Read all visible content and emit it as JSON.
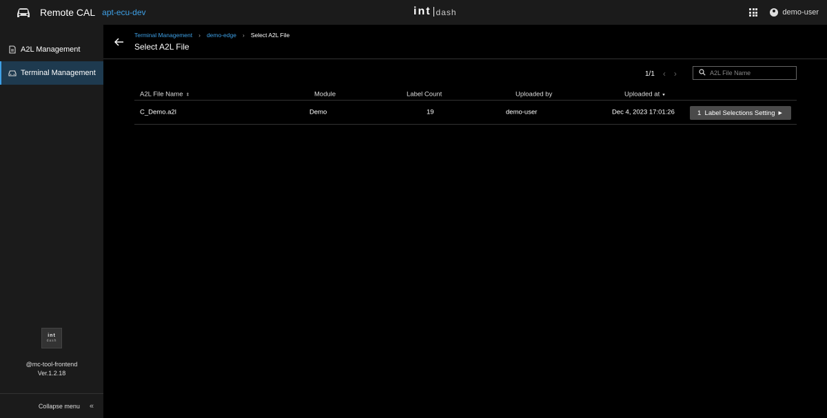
{
  "topbar": {
    "app_title": "Remote CAL",
    "project": "apt-ecu-dev",
    "brand_left": "int",
    "brand_right": "dash",
    "user_name": "demo-user",
    "icons": [
      "car-icon",
      "apps-grid-icon",
      "account-circle-icon"
    ]
  },
  "sidebar": {
    "items": [
      {
        "label": "A2L Management",
        "icon": "document-icon",
        "active": false
      },
      {
        "label": "Terminal Management",
        "icon": "car-icon",
        "active": true
      }
    ],
    "footer": {
      "logo_top": "int",
      "logo_bottom": "dash",
      "package": "@mc-tool-frontend",
      "version": "Ver.1.2.18"
    },
    "collapse_label": "Collapse menu"
  },
  "header": {
    "breadcrumb": [
      "Terminal Management",
      "demo-edge",
      "Select A2L File"
    ],
    "title": "Select A2L File"
  },
  "pager": {
    "text": "1/1"
  },
  "search": {
    "placeholder": "A2L File Name",
    "value": ""
  },
  "table": {
    "columns": [
      "A2L File Name",
      "Module",
      "Label Count",
      "Uploaded by",
      "Uploaded at"
    ],
    "rows": [
      {
        "file_name": "C_Demo.a2l",
        "module": "Demo",
        "label_count": "19",
        "uploaded_by": "demo-user",
        "uploaded_at": "Dec 4, 2023 17:01:26",
        "action": "1  Label Selections Setting"
      }
    ]
  },
  "colors": {
    "accent": "#3ea0e6",
    "background": "#000000",
    "panel": "#1b1b1b",
    "button": "#4a4a4a"
  }
}
